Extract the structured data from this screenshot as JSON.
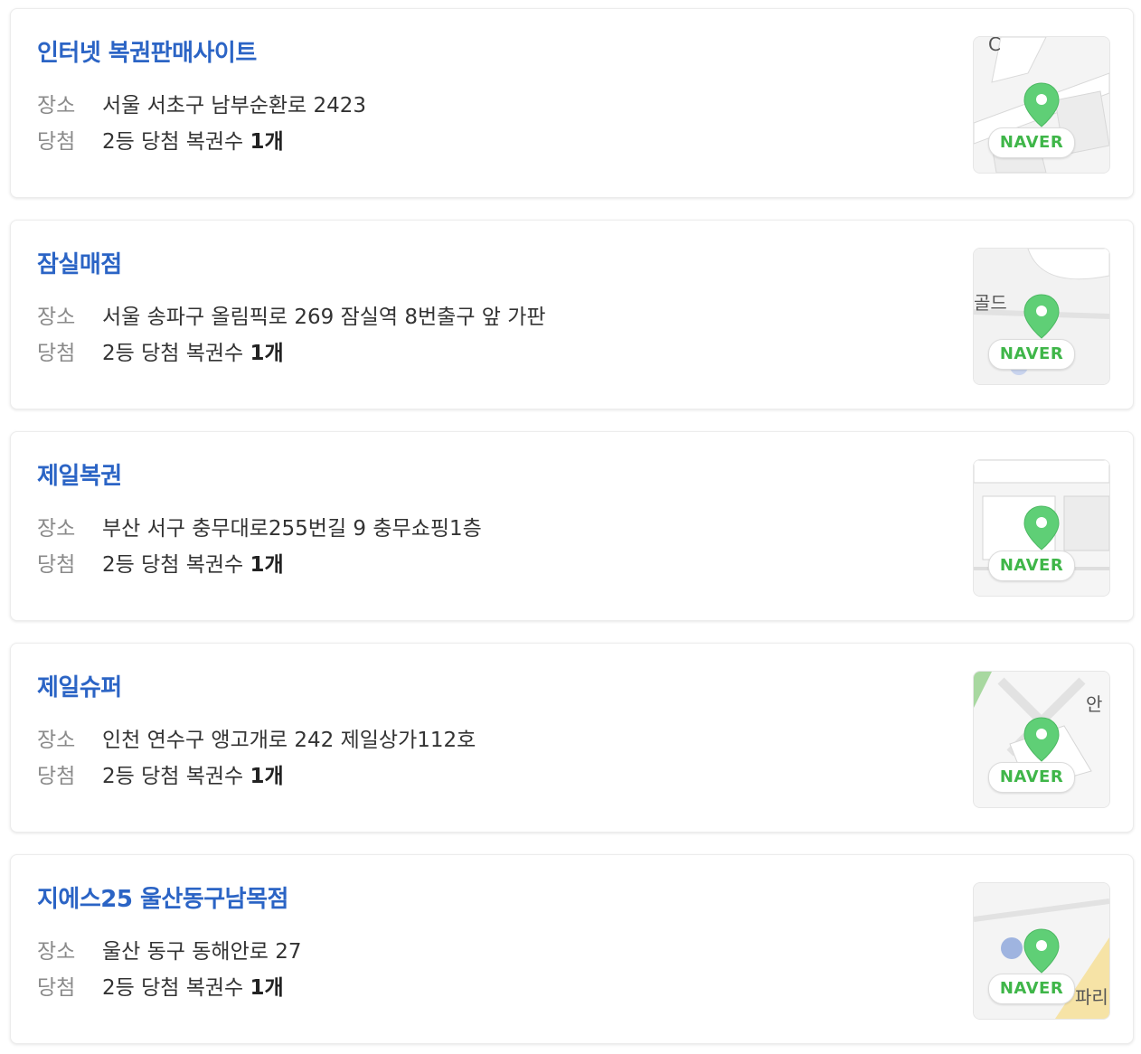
{
  "labels": {
    "place": "장소",
    "win": "당첨",
    "win_prefix": "2등 당첨 복권수 ",
    "naver": "NAVER"
  },
  "stores": [
    {
      "name": "인터넷 복권판매사이트",
      "address": "서울 서초구 남부순환로 2423",
      "count": "1개",
      "map_text": "C"
    },
    {
      "name": "잠실매점",
      "address": "서울 송파구 올림픽로 269 잠실역 8번출구 앞 가판",
      "count": "1개",
      "map_text": "골드"
    },
    {
      "name": "제일복권",
      "address": "부산 서구 충무대로255번길 9 충무쇼핑1층",
      "count": "1개",
      "map_text": ""
    },
    {
      "name": "제일슈퍼",
      "address": "인천 연수구 앵고개로 242 제일상가112호",
      "count": "1개",
      "map_text": "안"
    },
    {
      "name": "지에스25 울산동구남목점",
      "address": "울산 동구 동해안로 27",
      "count": "1개",
      "map_text": "파리"
    }
  ],
  "colors": {
    "title": "#2b64c5",
    "pin": "#5fcf76",
    "naver": "#3fb649"
  },
  "icons": {
    "map_pin": "map-pin-icon"
  }
}
